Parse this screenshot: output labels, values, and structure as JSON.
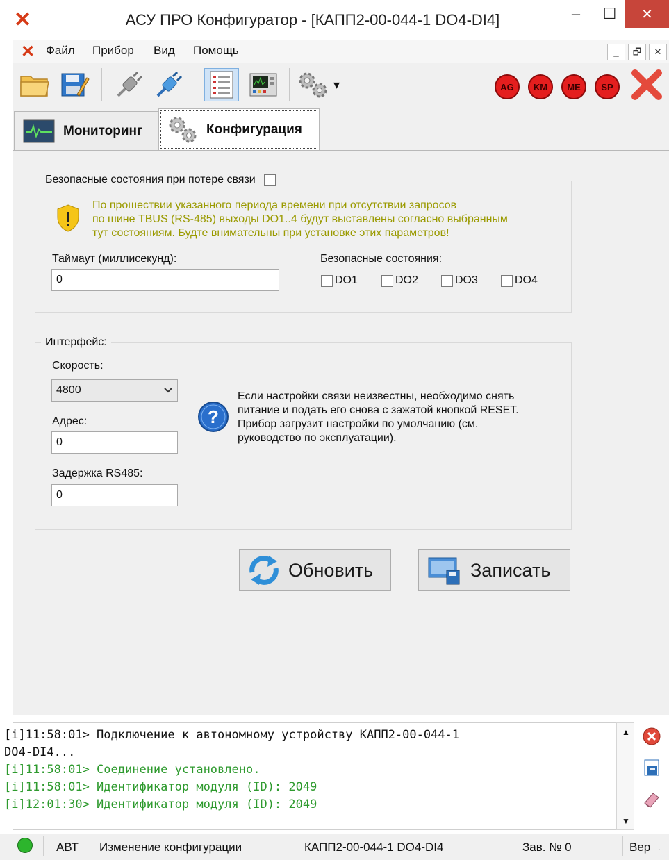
{
  "window": {
    "title": "АСУ ПРО Конфигуратор - [КАПП2-00-044-1 DO4-DI4]",
    "min": "–",
    "max": "☐",
    "close": "✕"
  },
  "menu": {
    "items": [
      "Файл",
      "Прибор",
      "Вид",
      "Помощь"
    ],
    "mdi_min": "_",
    "mdi_restore": "🗗",
    "mdi_close": "✕"
  },
  "toolbar": {
    "red_buttons": [
      "AG",
      "KM",
      "ME",
      "SP"
    ],
    "dropdown_arrow": "▾"
  },
  "tabs": {
    "monitoring": "Мониторинг",
    "config": "Конфигурация"
  },
  "safe_group": {
    "legend": "Безопасные состояния при потере связи",
    "enabled": false,
    "warning_lines": [
      "По прошествии указанного периода времени при отсутствии запросов",
      "по шине TBUS (RS-485) выходы DO1..4 будут выставлены согласно выбранным",
      "тут состояниям. Будте внимательны при установке этих параметров!"
    ],
    "timeout_label": "Таймаут (миллисекунд):",
    "timeout_value": "0",
    "safe_states_label": "Безопасные состояния:",
    "outputs": [
      "DO1",
      "DO2",
      "DO3",
      "DO4"
    ]
  },
  "interface_group": {
    "legend": "Интерфейс:",
    "speed_label": "Скорость:",
    "speed_value": "4800",
    "address_label": "Адрес:",
    "address_value": "0",
    "delay_label": "Задержка RS485:",
    "delay_value": "0",
    "info_lines": [
      "Если настройки связи неизвестны, необходимо снять",
      "питание и подать его снова с зажатой кнопкой RESET.",
      "Прибор загрузит настройки по умолчанию (см.",
      "руководство по эксплуатации)."
    ]
  },
  "buttons": {
    "refresh": "Обновить",
    "write": "Записать"
  },
  "log": {
    "lines": [
      {
        "text": "[i]11:58:01> Подключение к автономному устройству КАПП2-00-044-1",
        "color": "#111111"
      },
      {
        "text": "DO4-DI4...",
        "color": "#111111"
      },
      {
        "text": "[i]11:58:01> Соединение установлено.",
        "color": "#2e9a2e"
      },
      {
        "text": "[i]11:58:01> Идентификатор модуля (ID): 2049",
        "color": "#2e9a2e"
      },
      {
        "text": "[i]12:01:30> Идентификатор модуля (ID): 2049",
        "color": "#2e9a2e"
      }
    ]
  },
  "status": {
    "indicator_color": "#2db52d",
    "mode": "АВТ",
    "action": "Изменение конфигурации",
    "device": "КАПП2-00-044-1 DO4-DI4",
    "serial": "Зав. № 0",
    "version": "Вер"
  },
  "colors": {
    "accent_red": "#e41e1e",
    "warning_yellow": "#9a9a00",
    "log_green": "#2e9a2e"
  }
}
